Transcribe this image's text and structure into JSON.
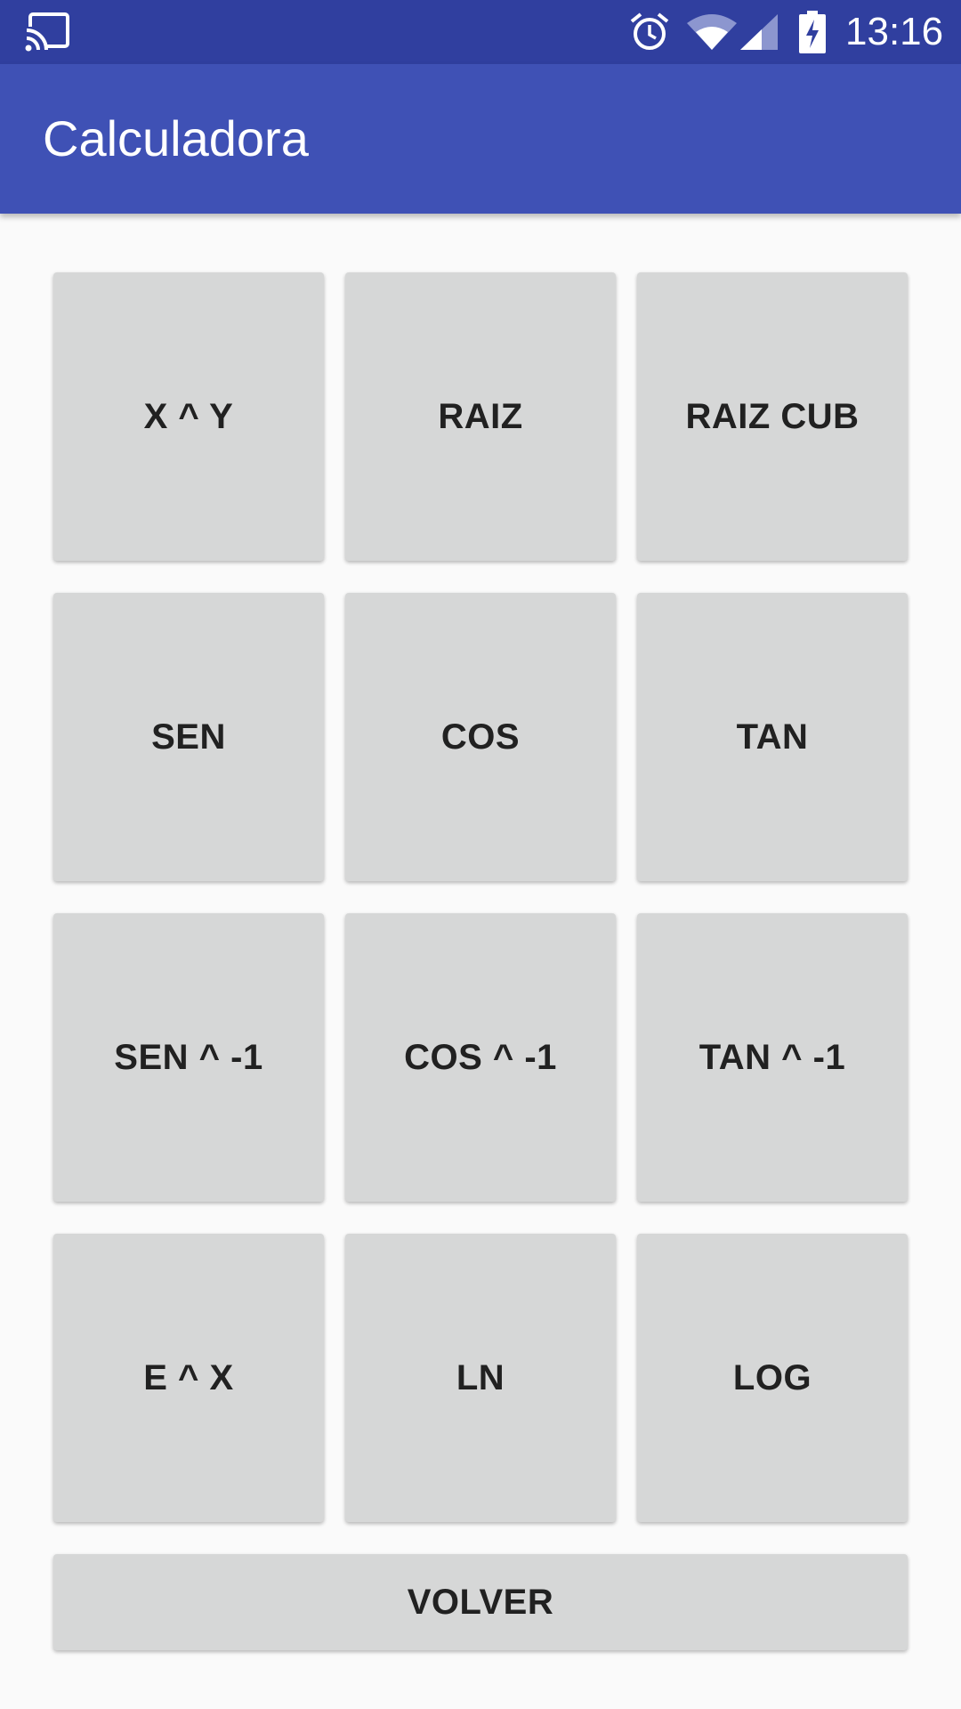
{
  "status_bar": {
    "time": "13:16",
    "icons": [
      "cast-icon",
      "alarm-icon",
      "wifi-icon",
      "signal-icon",
      "battery-charging-icon"
    ]
  },
  "app_bar": {
    "title": "Calculadora",
    "color": "#3f51b5"
  },
  "buttons": [
    [
      "X ^ Y",
      "RAIZ",
      "RAIZ CUB"
    ],
    [
      "SEN",
      "COS",
      "TAN"
    ],
    [
      "SEN ^ -1",
      "COS ^ -1",
      "TAN ^ -1"
    ],
    [
      "E ^ X",
      "LN",
      "LOG"
    ]
  ],
  "volver_label": "VOLVER",
  "colors": {
    "status_bar": "#303f9f",
    "button_bg": "#d6d7d7",
    "button_text": "#212121",
    "background": "#fafafa"
  }
}
